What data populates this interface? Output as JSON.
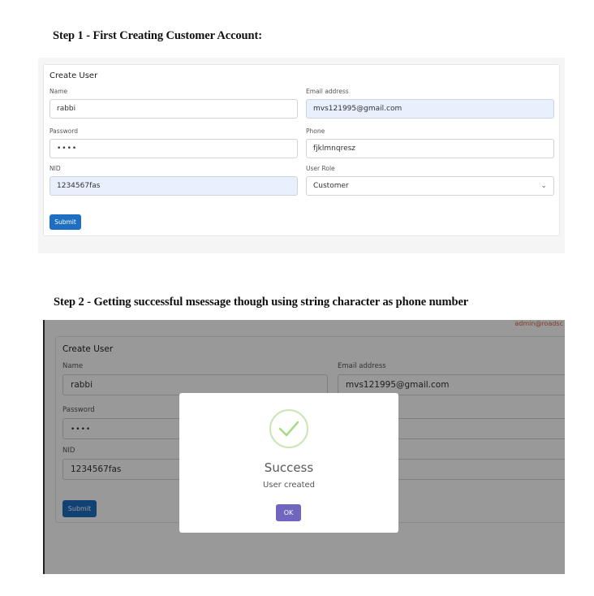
{
  "step1": {
    "heading": "Step 1 - First Creating Customer Account:",
    "form": {
      "title": "Create User",
      "name_label": "Name",
      "name_value": "rabbi",
      "email_label": "Email address",
      "email_value": "mvs121995@gmail.com",
      "password_label": "Password",
      "password_value": "••••",
      "phone_label": "Phone",
      "phone_value": "fjklmnqresz",
      "nid_label": "NID",
      "nid_value": "1234567fas",
      "role_label": "User Role",
      "role_value": "Customer",
      "submit_label": "Submit"
    }
  },
  "step2": {
    "heading": "Step 2 - Getting successful msessage  though using string character as phone number",
    "header_link": "admin@roadsc",
    "form": {
      "title": "Create User",
      "name_label": "Name",
      "name_value": "rabbi",
      "email_label": "Email address",
      "email_value": "mvs121995@gmail.com",
      "password_label": "Password",
      "password_value": "••••",
      "nid_label": "NID",
      "nid_value": "1234567fas",
      "submit_label": "Submit"
    },
    "modal": {
      "icon": "check-circle-icon",
      "title": "Success",
      "message": "User created",
      "ok_label": "OK"
    }
  },
  "colors": {
    "primary_button": "#1e6fc2",
    "ok_button": "#7066c0",
    "success_green": "#a5dc86",
    "autofill_bg": "#e8f0fe",
    "header_link": "#d9613a"
  }
}
